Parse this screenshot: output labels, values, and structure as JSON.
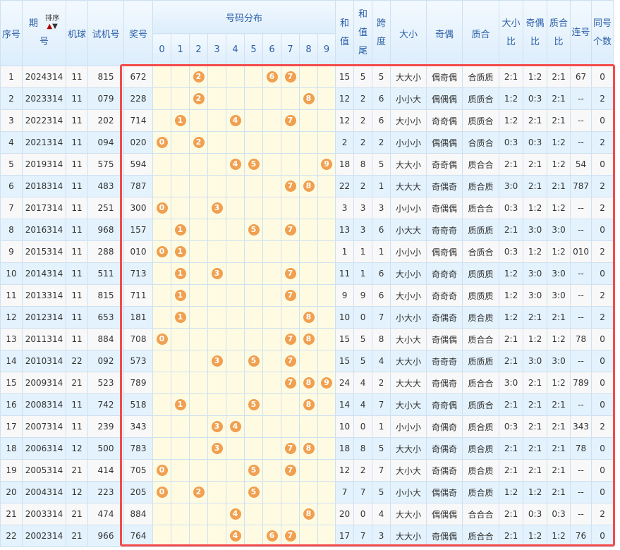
{
  "header": {
    "idx": "序号",
    "period": "期号",
    "period_a": "期",
    "period_b": "号",
    "sort_label": "排序",
    "ball": "机球",
    "test": "试机号",
    "prize": "奖号",
    "dist": "号码分布",
    "digits": [
      "0",
      "1",
      "2",
      "3",
      "4",
      "5",
      "6",
      "7",
      "8",
      "9"
    ],
    "sum": "和值",
    "tail": "和值尾",
    "span": "跨度",
    "dx": "大小",
    "jo": "奇偶",
    "zh": "质合",
    "dxb": "大小比",
    "job": "奇偶比",
    "zhb": "质合比",
    "lian": "连号",
    "tong": "同号个数"
  },
  "colors": {
    "ball": "#f0a050",
    "highlight": "#f44b4b",
    "row_even": "#e3f2fd",
    "digit_bg": "#fffbe3"
  },
  "rows": [
    [
      "1",
      "2024314",
      "11",
      "815",
      "672",
      "15",
      "5",
      "5",
      "大大小",
      "偶奇偶",
      "合质质",
      "2:1",
      "1:2",
      "2:1",
      "67",
      "0"
    ],
    [
      "2",
      "2023314",
      "11",
      "079",
      "228",
      "12",
      "2",
      "6",
      "小小大",
      "偶偶偶",
      "质质合",
      "1:2",
      "0:3",
      "2:1",
      "--",
      "2"
    ],
    [
      "3",
      "2022314",
      "11",
      "202",
      "714",
      "12",
      "2",
      "6",
      "大小小",
      "奇奇偶",
      "质质合",
      "1:2",
      "2:1",
      "2:1",
      "--",
      "0"
    ],
    [
      "4",
      "2021314",
      "11",
      "094",
      "020",
      "2",
      "2",
      "2",
      "小小小",
      "偶偶偶",
      "合质合",
      "0:3",
      "0:3",
      "1:2",
      "--",
      "2"
    ],
    [
      "5",
      "2019314",
      "11",
      "575",
      "594",
      "18",
      "8",
      "5",
      "大大小",
      "奇奇偶",
      "质合合",
      "2:1",
      "2:1",
      "1:2",
      "54",
      "0"
    ],
    [
      "6",
      "2018314",
      "11",
      "483",
      "787",
      "22",
      "2",
      "1",
      "大大大",
      "奇偶奇",
      "质合质",
      "3:0",
      "2:1",
      "2:1",
      "787",
      "2"
    ],
    [
      "7",
      "2017314",
      "11",
      "251",
      "300",
      "3",
      "3",
      "3",
      "小小小",
      "奇偶偶",
      "质合合",
      "0:3",
      "1:2",
      "1:2",
      "--",
      "2"
    ],
    [
      "8",
      "2016314",
      "11",
      "968",
      "157",
      "13",
      "3",
      "6",
      "小大大",
      "奇奇奇",
      "质质质",
      "2:1",
      "3:0",
      "3:0",
      "--",
      "0"
    ],
    [
      "9",
      "2015314",
      "11",
      "288",
      "010",
      "1",
      "1",
      "1",
      "小小小",
      "偶奇偶",
      "合质合",
      "0:3",
      "1:2",
      "1:2",
      "010",
      "2"
    ],
    [
      "10",
      "2014314",
      "11",
      "511",
      "713",
      "11",
      "1",
      "6",
      "大小小",
      "奇奇奇",
      "质质质",
      "1:2",
      "3:0",
      "3:0",
      "--",
      "0"
    ],
    [
      "11",
      "2013314",
      "11",
      "815",
      "711",
      "9",
      "9",
      "6",
      "大小小",
      "奇奇奇",
      "质质质",
      "1:2",
      "3:0",
      "3:0",
      "--",
      "2"
    ],
    [
      "12",
      "2012314",
      "11",
      "653",
      "181",
      "10",
      "0",
      "7",
      "小大小",
      "奇偶奇",
      "质合质",
      "1:2",
      "2:1",
      "2:1",
      "--",
      "2"
    ],
    [
      "13",
      "2011314",
      "11",
      "884",
      "708",
      "15",
      "5",
      "8",
      "大小大",
      "奇偶偶",
      "质合合",
      "2:1",
      "1:2",
      "1:2",
      "78",
      "0"
    ],
    [
      "14",
      "2010314",
      "22",
      "092",
      "573",
      "15",
      "5",
      "4",
      "大大小",
      "奇奇奇",
      "质质质",
      "2:1",
      "3:0",
      "3:0",
      "--",
      "0"
    ],
    [
      "15",
      "2009314",
      "21",
      "523",
      "789",
      "24",
      "4",
      "2",
      "大大大",
      "奇偶奇",
      "质合合",
      "3:0",
      "2:1",
      "1:2",
      "789",
      "0"
    ],
    [
      "16",
      "2008314",
      "11",
      "742",
      "518",
      "14",
      "4",
      "7",
      "大小大",
      "奇奇偶",
      "质质合",
      "2:1",
      "2:1",
      "2:1",
      "--",
      "0"
    ],
    [
      "17",
      "2007314",
      "11",
      "239",
      "343",
      "10",
      "0",
      "1",
      "小小小",
      "奇偶奇",
      "质合质",
      "0:3",
      "2:1",
      "2:1",
      "343",
      "2"
    ],
    [
      "18",
      "2006314",
      "12",
      "500",
      "783",
      "18",
      "8",
      "5",
      "大大小",
      "奇偶奇",
      "质合质",
      "2:1",
      "2:1",
      "2:1",
      "78",
      "0"
    ],
    [
      "19",
      "2005314",
      "21",
      "414",
      "705",
      "12",
      "2",
      "7",
      "大小大",
      "奇偶奇",
      "质合质",
      "2:1",
      "2:1",
      "2:1",
      "--",
      "0"
    ],
    [
      "20",
      "2004314",
      "12",
      "223",
      "205",
      "7",
      "7",
      "5",
      "小小大",
      "偶偶奇",
      "质合质",
      "1:2",
      "1:2",
      "2:1",
      "--",
      "0"
    ],
    [
      "21",
      "2003314",
      "21",
      "474",
      "884",
      "20",
      "0",
      "4",
      "大大小",
      "偶偶偶",
      "合合合",
      "2:1",
      "0:3",
      "0:3",
      "--",
      "2"
    ],
    [
      "22",
      "2002314",
      "21",
      "966",
      "764",
      "17",
      "7",
      "3",
      "大大小",
      "奇偶偶",
      "质合合",
      "2:1",
      "1:2",
      "1:2",
      "76",
      "0"
    ]
  ]
}
